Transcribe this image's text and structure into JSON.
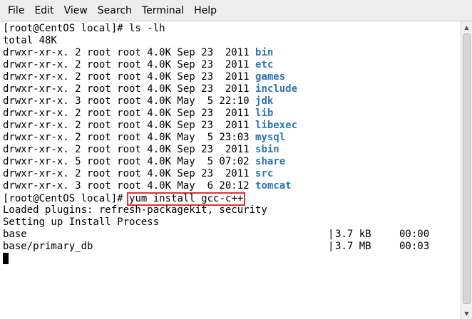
{
  "menu": {
    "file": "File",
    "edit": "Edit",
    "view": "View",
    "search": "Search",
    "terminal": "Terminal",
    "help": "Help"
  },
  "terminal": {
    "prompt1": "[root@CentOS local]# ls -lh",
    "total": "total 48K",
    "listing": [
      {
        "perms": "drwxr-xr-x. 2 root root 4.0K Sep 23  2011 ",
        "name": "bin"
      },
      {
        "perms": "drwxr-xr-x. 2 root root 4.0K Sep 23  2011 ",
        "name": "etc"
      },
      {
        "perms": "drwxr-xr-x. 2 root root 4.0K Sep 23  2011 ",
        "name": "games"
      },
      {
        "perms": "drwxr-xr-x. 2 root root 4.0K Sep 23  2011 ",
        "name": "include"
      },
      {
        "perms": "drwxr-xr-x. 3 root root 4.0K May  5 22:10 ",
        "name": "jdk"
      },
      {
        "perms": "drwxr-xr-x. 2 root root 4.0K Sep 23  2011 ",
        "name": "lib"
      },
      {
        "perms": "drwxr-xr-x. 2 root root 4.0K Sep 23  2011 ",
        "name": "libexec"
      },
      {
        "perms": "drwxr-xr-x. 2 root root 4.0K May  5 23:03 ",
        "name": "mysql"
      },
      {
        "perms": "drwxr-xr-x. 2 root root 4.0K Sep 23  2011 ",
        "name": "sbin"
      },
      {
        "perms": "drwxr-xr-x. 5 root root 4.0K May  5 07:02 ",
        "name": "share"
      },
      {
        "perms": "drwxr-xr-x. 2 root root 4.0K Sep 23  2011 ",
        "name": "src"
      },
      {
        "perms": "drwxr-xr-x. 3 root root 4.0K May  6 20:12 ",
        "name": "tomcat"
      }
    ],
    "prompt2": "[root@CentOS local]# ",
    "command2": "yum install gcc-c++",
    "loaded_plugins": "Loaded plugins: refresh-packagekit, security",
    "setting_up": "Setting up Install Process",
    "repos": [
      {
        "name": "base",
        "sep": "|",
        "size": "3.7 kB",
        "time": "00:00"
      },
      {
        "name": "base/primary_db",
        "sep": "|",
        "size": "3.7 MB",
        "time": "00:03"
      }
    ]
  },
  "colors": {
    "directory": "#2e76b4",
    "highlight_box": "#e03030"
  },
  "scrollbar": {
    "up_icon": "arrow-up",
    "down_icon": "arrow-down"
  }
}
